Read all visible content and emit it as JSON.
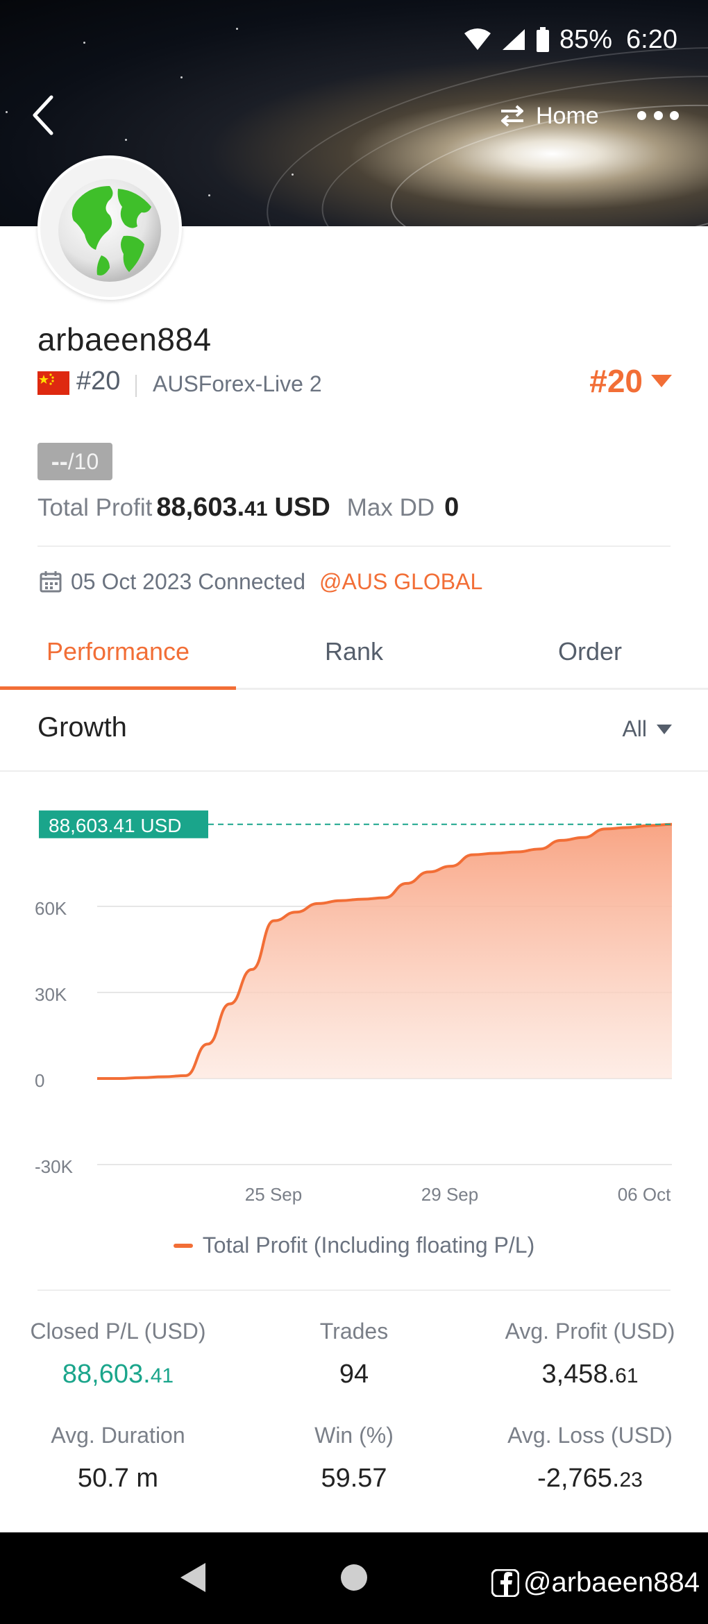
{
  "status_bar": {
    "battery": "85%",
    "time": "6:20"
  },
  "top_nav": {
    "home_label": "Home"
  },
  "profile": {
    "username": "arbaeen884",
    "rank_small": "#20",
    "server": "AUSForex-Live 2",
    "rank_big": "#20",
    "score_dash": "--",
    "score_total": "/10",
    "total_profit_label": "Total Profit",
    "total_profit_int": "88,603.",
    "total_profit_dec": "41",
    "total_profit_unit": "USD",
    "max_dd_label": "Max DD",
    "max_dd_value": "0",
    "connected_text": "05 Oct 2023 Connected",
    "broker": "@AUS GLOBAL"
  },
  "tabs": [
    {
      "label": "Performance"
    },
    {
      "label": "Rank"
    },
    {
      "label": "Order"
    }
  ],
  "growth": {
    "title": "Growth",
    "range": "All"
  },
  "chart_data": {
    "type": "area",
    "y_ticks": [
      "60K",
      "30K",
      "0",
      "-30K"
    ],
    "x_ticks": [
      "25 Sep",
      "29 Sep",
      "06 Oct"
    ],
    "ylim": [
      -30000,
      90000
    ],
    "tooltip": "88,603.41 USD",
    "series": [
      {
        "name": "Total Profit (Including floating P/L)",
        "color": "#f26e36",
        "values": [
          0,
          0,
          300,
          600,
          1000,
          12000,
          26000,
          38000,
          55000,
          58000,
          61000,
          62000,
          62500,
          63000,
          68000,
          72000,
          74000,
          78000,
          78500,
          79000,
          80000,
          83000,
          84000,
          87000,
          87500,
          88200,
          88603.41
        ]
      }
    ]
  },
  "legend_label": "Total Profit (Including floating P/L)",
  "stats": {
    "closed_pl_label": "Closed P/L (USD)",
    "closed_pl_int": "88,603.",
    "closed_pl_dec": "41",
    "trades_label": "Trades",
    "trades_value": "94",
    "avg_profit_label": "Avg. Profit (USD)",
    "avg_profit_int": "3,458.",
    "avg_profit_dec": "61",
    "avg_duration_label": "Avg. Duration",
    "avg_duration_value": "50.7 m",
    "win_label": "Win (%)",
    "win_value": "59.57",
    "avg_loss_label": "Avg. Loss (USD)",
    "avg_loss_int": "-2,765.",
    "avg_loss_dec": "23"
  },
  "watermark": "@arbaeen884"
}
